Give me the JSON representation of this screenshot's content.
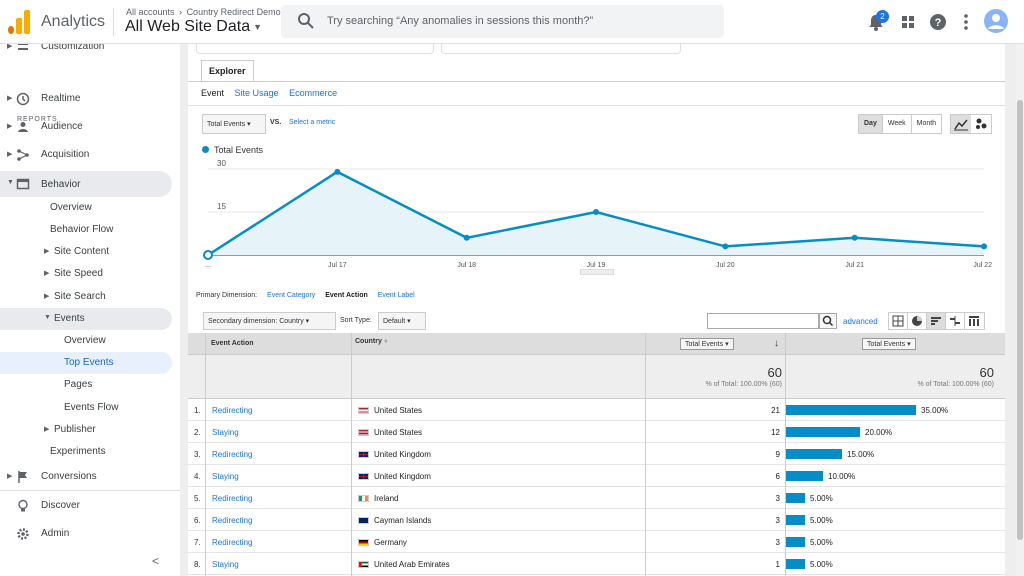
{
  "header": {
    "app_title": "Analytics",
    "breadcrumb": [
      "All accounts",
      "Country Redirect Demo"
    ],
    "breadcrumb_sep": "›",
    "property": "All Web Site Data",
    "search_placeholder": "Try searching “Any anomalies in sessions this month?”",
    "notification_count": "2",
    "logo_colors": [
      "#f9ab00",
      "#e37400"
    ],
    "icons": [
      "search-icon",
      "bell-icon",
      "apps-icon",
      "help-icon",
      "more-vert-icon",
      "account-avatar"
    ]
  },
  "sidebar": {
    "top_partial": "Customization",
    "section_label": "REPORTS",
    "items": [
      {
        "label": "Realtime",
        "icon": "clock-icon"
      },
      {
        "label": "Audience",
        "icon": "person-icon"
      },
      {
        "label": "Acquisition",
        "icon": "acquisition-icon"
      },
      {
        "label": "Behavior",
        "icon": "behavior-icon"
      }
    ],
    "behavior_children": [
      "Overview",
      "Behavior Flow",
      "Site Content",
      "Site Speed",
      "Site Search",
      "Events"
    ],
    "events_children": [
      "Overview",
      "Top Events",
      "Pages",
      "Events Flow"
    ],
    "after": [
      "Publisher",
      "Experiments"
    ],
    "conversions": "Conversions",
    "discover": "Discover",
    "admin": "Admin",
    "collapse_glyph": "<"
  },
  "explorer": {
    "tab": "Explorer",
    "subtabs": [
      "Event",
      "Site Usage",
      "Ecommerce"
    ],
    "metric_select": "Total Events",
    "vs": "VS.",
    "select_metric": "Select a metric",
    "periods": [
      "Day",
      "Week",
      "Month"
    ],
    "active_period": "Day"
  },
  "chart_data": {
    "type": "area",
    "series": [
      {
        "name": "Total Events",
        "values": [
          0,
          29,
          6,
          15,
          3,
          6,
          3
        ]
      }
    ],
    "x": [
      "",
      "Jul 17",
      "Jul 18",
      "Jul 19",
      "Jul 20",
      "Jul 21",
      "Jul 22"
    ],
    "x_first_label": "...",
    "yticks": [
      "30",
      "15"
    ],
    "ylim": [
      0,
      30
    ],
    "grid": true,
    "color": "#058dc7",
    "fill": "#e6f4f9"
  },
  "dimensions": {
    "label": "Primary Dimension:",
    "options": [
      "Event Category",
      "Event Action",
      "Event Label"
    ],
    "current": "Event Action",
    "secondary": "Secondary dimension: Country",
    "sort_label": "Sort Type:",
    "sort_value": "Default",
    "advanced": "advanced"
  },
  "table": {
    "headers": {
      "action": "Event Action",
      "country": "Country",
      "col1": "Total Events",
      "col2": "Total Events"
    },
    "summary": {
      "total": "60",
      "pct": "% of Total: 100.00% (60)"
    },
    "rows": [
      {
        "n": "1.",
        "action": "Redirecting",
        "country": "United States",
        "flag": "us",
        "value": "21",
        "pct": "35.00%",
        "share": 35
      },
      {
        "n": "2.",
        "action": "Staying",
        "country": "United States",
        "flag": "us",
        "value": "12",
        "pct": "20.00%",
        "share": 20
      },
      {
        "n": "3.",
        "action": "Redirecting",
        "country": "United Kingdom",
        "flag": "uk",
        "value": "9",
        "pct": "15.00%",
        "share": 15
      },
      {
        "n": "4.",
        "action": "Staying",
        "country": "United Kingdom",
        "flag": "uk",
        "value": "6",
        "pct": "10.00%",
        "share": 10
      },
      {
        "n": "5.",
        "action": "Redirecting",
        "country": "Ireland",
        "flag": "ie",
        "value": "3",
        "pct": "5.00%",
        "share": 5
      },
      {
        "n": "6.",
        "action": "Redirecting",
        "country": "Cayman Islands",
        "flag": "ky",
        "value": "3",
        "pct": "5.00%",
        "share": 5
      },
      {
        "n": "7.",
        "action": "Redirecting",
        "country": "Germany",
        "flag": "de",
        "value": "3",
        "pct": "5.00%",
        "share": 5
      },
      {
        "n": "8.",
        "action": "Staying",
        "country": "United Arab Emirates",
        "flag": "ae",
        "value": "1",
        "pct": "5.00%",
        "share": 5
      }
    ]
  }
}
